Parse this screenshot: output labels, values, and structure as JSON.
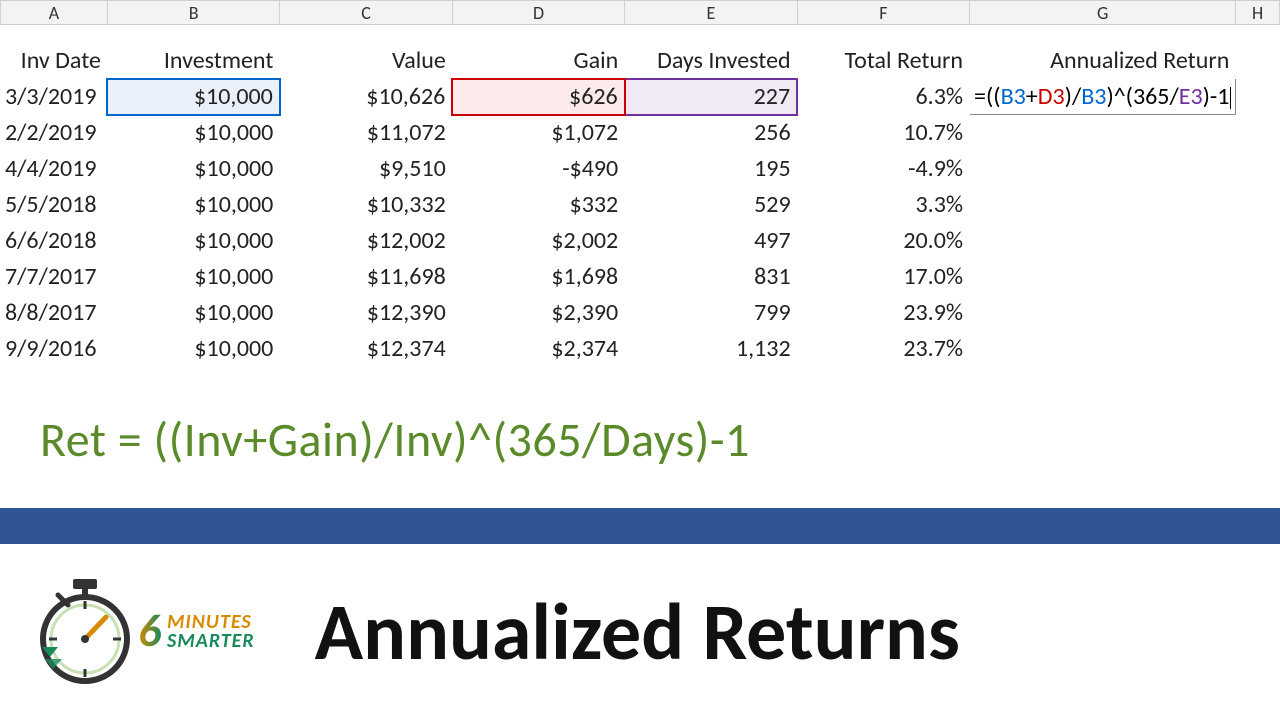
{
  "columns": [
    "A",
    "B",
    "C",
    "D",
    "E",
    "F",
    "G",
    "H"
  ],
  "headers": {
    "A": "Inv Date",
    "B": "Investment",
    "C": "Value",
    "D": "Gain",
    "E": "Days Invested",
    "F": "Total Return",
    "G": "Annualized Return"
  },
  "rows": [
    {
      "A": "3/3/2019",
      "B": "$10,000",
      "C": "$10,626",
      "D": "$626",
      "E": "227",
      "F": "6.3%"
    },
    {
      "A": "2/2/2019",
      "B": "$10,000",
      "C": "$11,072",
      "D": "$1,072",
      "E": "256",
      "F": "10.7%"
    },
    {
      "A": "4/4/2019",
      "B": "$10,000",
      "C": "$9,510",
      "D": "-$490",
      "E": "195",
      "F": "-4.9%"
    },
    {
      "A": "5/5/2018",
      "B": "$10,000",
      "C": "$10,332",
      "D": "$332",
      "E": "529",
      "F": "3.3%"
    },
    {
      "A": "6/6/2018",
      "B": "$10,000",
      "C": "$12,002",
      "D": "$2,002",
      "E": "497",
      "F": "20.0%"
    },
    {
      "A": "7/7/2017",
      "B": "$10,000",
      "C": "$11,698",
      "D": "$1,698",
      "E": "831",
      "F": "17.0%"
    },
    {
      "A": "8/8/2017",
      "B": "$10,000",
      "C": "$12,390",
      "D": "$2,390",
      "E": "799",
      "F": "23.9%"
    },
    {
      "A": "9/9/2016",
      "B": "$10,000",
      "C": "$12,374",
      "D": "$2,374",
      "E": "1,132",
      "F": "23.7%"
    }
  ],
  "formula": {
    "prefix": "=((",
    "ref1": "B3",
    "plus": "+",
    "ref2": "D3",
    "mid1": ")/",
    "ref3": "B3",
    "mid2": ")^(365/",
    "ref4": "E3",
    "suffix": ")-1"
  },
  "big_formula": "Ret = ((Inv+Gain)/Inv)^(365/Days)-1",
  "logo": {
    "digit": "6",
    "word1": "MINUTES",
    "word2": "SMARTER"
  },
  "title": "Annualized Returns"
}
